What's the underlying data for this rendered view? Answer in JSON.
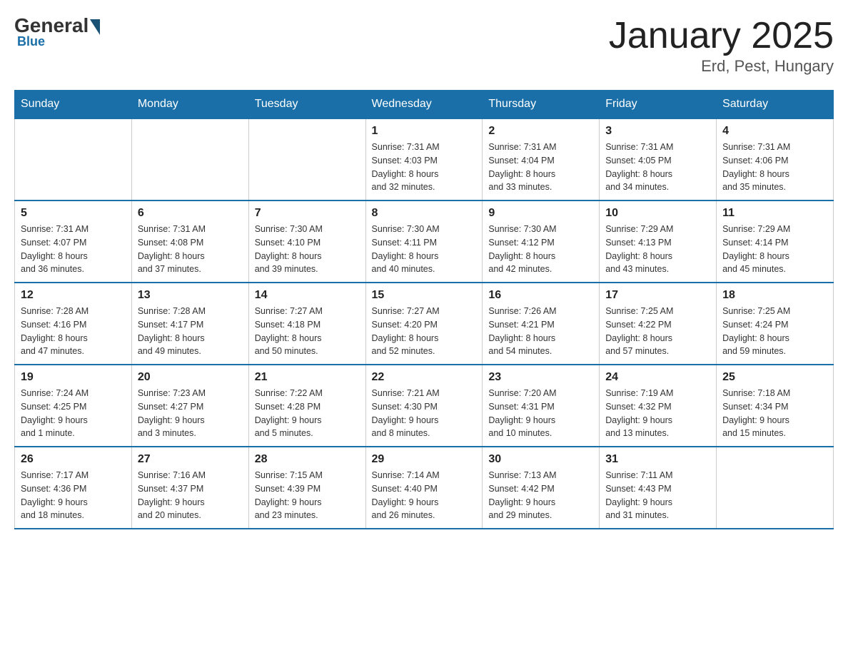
{
  "header": {
    "logo_general": "General",
    "logo_blue": "Blue",
    "title": "January 2025",
    "subtitle": "Erd, Pest, Hungary"
  },
  "weekdays": [
    "Sunday",
    "Monday",
    "Tuesday",
    "Wednesday",
    "Thursday",
    "Friday",
    "Saturday"
  ],
  "weeks": [
    [
      {
        "day": "",
        "info": ""
      },
      {
        "day": "",
        "info": ""
      },
      {
        "day": "",
        "info": ""
      },
      {
        "day": "1",
        "info": "Sunrise: 7:31 AM\nSunset: 4:03 PM\nDaylight: 8 hours\nand 32 minutes."
      },
      {
        "day": "2",
        "info": "Sunrise: 7:31 AM\nSunset: 4:04 PM\nDaylight: 8 hours\nand 33 minutes."
      },
      {
        "day": "3",
        "info": "Sunrise: 7:31 AM\nSunset: 4:05 PM\nDaylight: 8 hours\nand 34 minutes."
      },
      {
        "day": "4",
        "info": "Sunrise: 7:31 AM\nSunset: 4:06 PM\nDaylight: 8 hours\nand 35 minutes."
      }
    ],
    [
      {
        "day": "5",
        "info": "Sunrise: 7:31 AM\nSunset: 4:07 PM\nDaylight: 8 hours\nand 36 minutes."
      },
      {
        "day": "6",
        "info": "Sunrise: 7:31 AM\nSunset: 4:08 PM\nDaylight: 8 hours\nand 37 minutes."
      },
      {
        "day": "7",
        "info": "Sunrise: 7:30 AM\nSunset: 4:10 PM\nDaylight: 8 hours\nand 39 minutes."
      },
      {
        "day": "8",
        "info": "Sunrise: 7:30 AM\nSunset: 4:11 PM\nDaylight: 8 hours\nand 40 minutes."
      },
      {
        "day": "9",
        "info": "Sunrise: 7:30 AM\nSunset: 4:12 PM\nDaylight: 8 hours\nand 42 minutes."
      },
      {
        "day": "10",
        "info": "Sunrise: 7:29 AM\nSunset: 4:13 PM\nDaylight: 8 hours\nand 43 minutes."
      },
      {
        "day": "11",
        "info": "Sunrise: 7:29 AM\nSunset: 4:14 PM\nDaylight: 8 hours\nand 45 minutes."
      }
    ],
    [
      {
        "day": "12",
        "info": "Sunrise: 7:28 AM\nSunset: 4:16 PM\nDaylight: 8 hours\nand 47 minutes."
      },
      {
        "day": "13",
        "info": "Sunrise: 7:28 AM\nSunset: 4:17 PM\nDaylight: 8 hours\nand 49 minutes."
      },
      {
        "day": "14",
        "info": "Sunrise: 7:27 AM\nSunset: 4:18 PM\nDaylight: 8 hours\nand 50 minutes."
      },
      {
        "day": "15",
        "info": "Sunrise: 7:27 AM\nSunset: 4:20 PM\nDaylight: 8 hours\nand 52 minutes."
      },
      {
        "day": "16",
        "info": "Sunrise: 7:26 AM\nSunset: 4:21 PM\nDaylight: 8 hours\nand 54 minutes."
      },
      {
        "day": "17",
        "info": "Sunrise: 7:25 AM\nSunset: 4:22 PM\nDaylight: 8 hours\nand 57 minutes."
      },
      {
        "day": "18",
        "info": "Sunrise: 7:25 AM\nSunset: 4:24 PM\nDaylight: 8 hours\nand 59 minutes."
      }
    ],
    [
      {
        "day": "19",
        "info": "Sunrise: 7:24 AM\nSunset: 4:25 PM\nDaylight: 9 hours\nand 1 minute."
      },
      {
        "day": "20",
        "info": "Sunrise: 7:23 AM\nSunset: 4:27 PM\nDaylight: 9 hours\nand 3 minutes."
      },
      {
        "day": "21",
        "info": "Sunrise: 7:22 AM\nSunset: 4:28 PM\nDaylight: 9 hours\nand 5 minutes."
      },
      {
        "day": "22",
        "info": "Sunrise: 7:21 AM\nSunset: 4:30 PM\nDaylight: 9 hours\nand 8 minutes."
      },
      {
        "day": "23",
        "info": "Sunrise: 7:20 AM\nSunset: 4:31 PM\nDaylight: 9 hours\nand 10 minutes."
      },
      {
        "day": "24",
        "info": "Sunrise: 7:19 AM\nSunset: 4:32 PM\nDaylight: 9 hours\nand 13 minutes."
      },
      {
        "day": "25",
        "info": "Sunrise: 7:18 AM\nSunset: 4:34 PM\nDaylight: 9 hours\nand 15 minutes."
      }
    ],
    [
      {
        "day": "26",
        "info": "Sunrise: 7:17 AM\nSunset: 4:36 PM\nDaylight: 9 hours\nand 18 minutes."
      },
      {
        "day": "27",
        "info": "Sunrise: 7:16 AM\nSunset: 4:37 PM\nDaylight: 9 hours\nand 20 minutes."
      },
      {
        "day": "28",
        "info": "Sunrise: 7:15 AM\nSunset: 4:39 PM\nDaylight: 9 hours\nand 23 minutes."
      },
      {
        "day": "29",
        "info": "Sunrise: 7:14 AM\nSunset: 4:40 PM\nDaylight: 9 hours\nand 26 minutes."
      },
      {
        "day": "30",
        "info": "Sunrise: 7:13 AM\nSunset: 4:42 PM\nDaylight: 9 hours\nand 29 minutes."
      },
      {
        "day": "31",
        "info": "Sunrise: 7:11 AM\nSunset: 4:43 PM\nDaylight: 9 hours\nand 31 minutes."
      },
      {
        "day": "",
        "info": ""
      }
    ]
  ]
}
